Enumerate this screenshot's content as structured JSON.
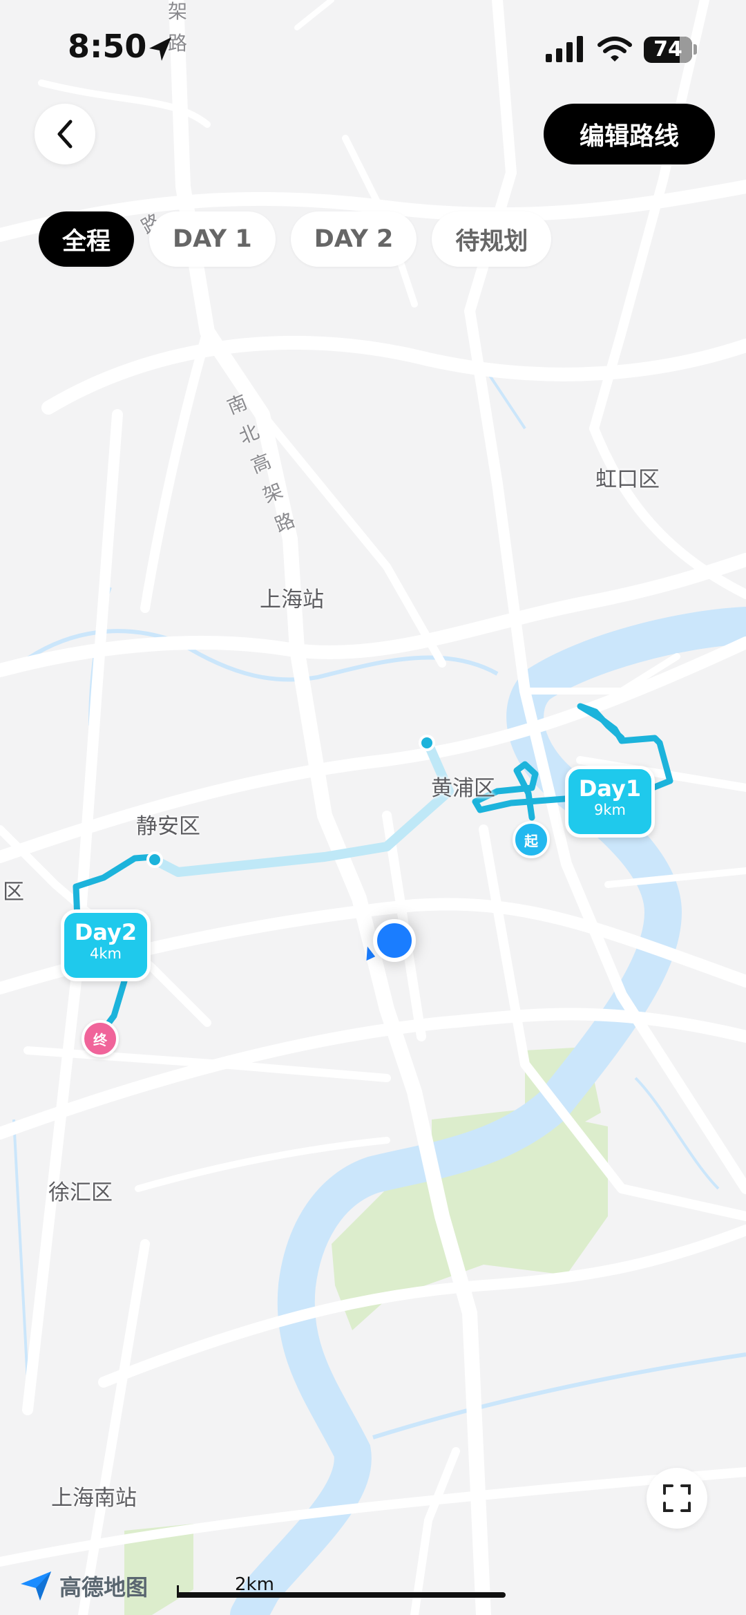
{
  "status_bar": {
    "time": "8:50",
    "battery": "74"
  },
  "header": {
    "back_icon": "chevron-left-icon",
    "edit_button": "编辑路线"
  },
  "tabs": [
    {
      "label": "全程",
      "active": true
    },
    {
      "label": "DAY 1",
      "active": false
    },
    {
      "label": "DAY 2",
      "active": false
    },
    {
      "label": "待规划",
      "active": false
    }
  ],
  "map": {
    "place_labels": {
      "hongkou": "虹口区",
      "shanghai_station": "上海站",
      "huangpu": "黄浦区",
      "jingan": "静安区",
      "qu_edge": "区",
      "xuhui": "徐汇区",
      "shanghai_south": "上海南站"
    },
    "road_labels": {
      "north_south_elevated": "南北高架路",
      "top_fragment": "架路",
      "tab_fragment": "路"
    },
    "routes": [
      {
        "label": "Day1",
        "distance": "9km",
        "color": "#2bbce8"
      },
      {
        "label": "Day2",
        "distance": "4km",
        "color": "#2bbce8"
      }
    ],
    "start_marker": "起",
    "end_marker": "终",
    "scale": "2km",
    "provider": "高德地图"
  },
  "colors": {
    "accent": "#1fc9ec",
    "river": "#cbe6fb",
    "park": "#dcedcc",
    "location": "#1a7dff"
  }
}
